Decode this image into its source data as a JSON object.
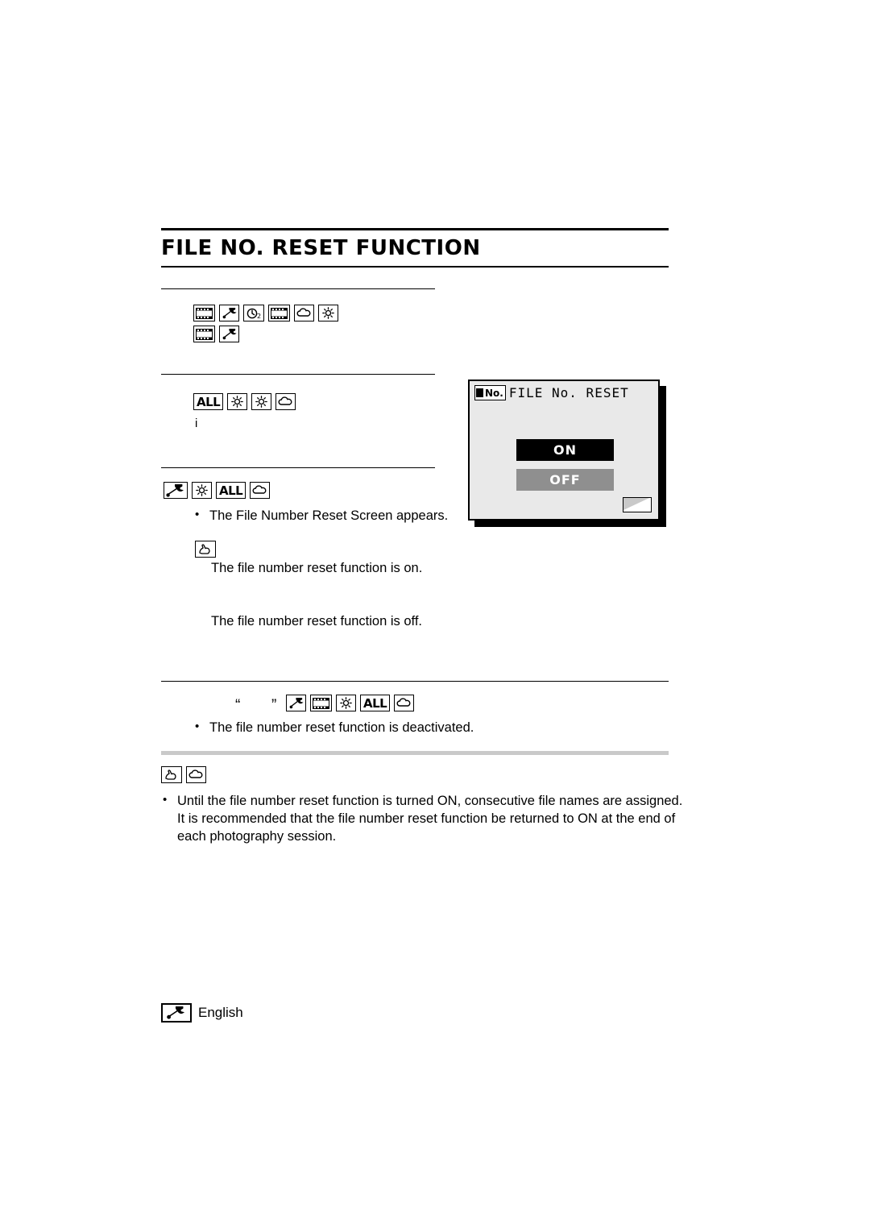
{
  "document": {
    "title": "FILE NO. RESET FUNCTION",
    "language_footer": "English"
  },
  "sections": {
    "intro_icons_label": "icon-sequence-intro",
    "setting_icons_label": "icon-sequence-setting",
    "procedure_icons_label": "icon-sequence-procedure"
  },
  "procedure": {
    "bullet1": "The File Number Reset Screen appears.",
    "line_on": "The file number reset function is on.",
    "line_off": "The file number reset function is off."
  },
  "cancel": {
    "quote_open": "“",
    "quote_close": "”",
    "bullet": "The file number reset function is deactivated."
  },
  "note": {
    "text": "Until the file number reset function is turned ON, consecutive file names are assigned. It is recommended that the file number reset function be returned to ON at the end of each photography session."
  },
  "lcd": {
    "badge_no": "No.",
    "header_title": "FILE No. RESET",
    "option_on": "ON",
    "option_off": "OFF"
  },
  "icons": {
    "film": "film-strip-icon",
    "wrench": "wrench-icon",
    "timer2": "self-timer-2-icon",
    "cloud": "cloud-icon",
    "sun": "sun-icon",
    "all": "ALL",
    "hand": "hand-pointer-icon",
    "small_i": "i"
  },
  "colors": {
    "accent_black": "#000000",
    "lcd_background": "#e9e9e9",
    "option_off_fill": "#8f8f8f",
    "grey_bar": "#c9c9c9"
  }
}
